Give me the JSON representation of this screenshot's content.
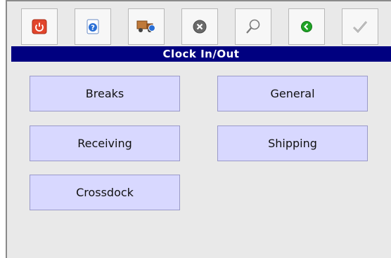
{
  "toolbar": {
    "buttons": [
      {
        "icon": "power-icon",
        "color": "#e2452c"
      },
      {
        "icon": "help-icon",
        "color": "#2a6fd6"
      },
      {
        "icon": "truck-icon",
        "color": "#9b5a2a"
      },
      {
        "icon": "close-icon",
        "color": "#6a6a6a"
      },
      {
        "icon": "search-icon",
        "color": "#7a7a7a"
      },
      {
        "icon": "back-icon",
        "color": "#1fa326"
      },
      {
        "icon": "checkmark-icon",
        "color": "#8a8a8a"
      }
    ]
  },
  "header": {
    "title": "Clock In/Out",
    "background": "#000080"
  },
  "menu": {
    "items": [
      {
        "label": "Breaks"
      },
      {
        "label": "General"
      },
      {
        "label": "Receiving"
      },
      {
        "label": "Shipping"
      },
      {
        "label": "Crossdock"
      }
    ]
  }
}
